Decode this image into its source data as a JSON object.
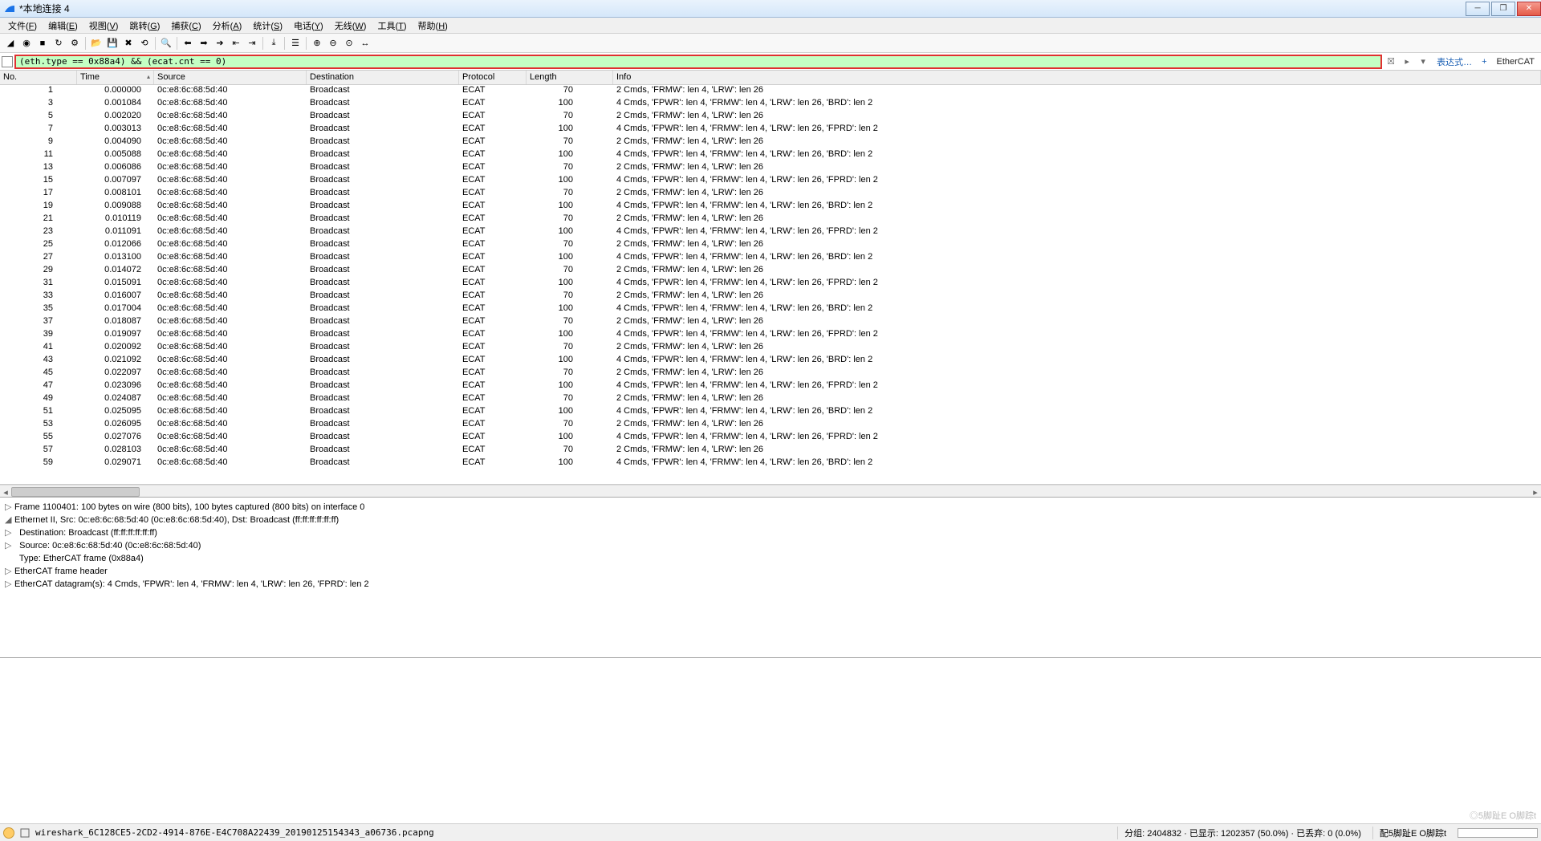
{
  "window": {
    "title": "*本地连接 4"
  },
  "menu": [
    {
      "l": "文件",
      "k": "F"
    },
    {
      "l": "编辑",
      "k": "E"
    },
    {
      "l": "视图",
      "k": "V"
    },
    {
      "l": "跳转",
      "k": "G"
    },
    {
      "l": "捕获",
      "k": "C"
    },
    {
      "l": "分析",
      "k": "A"
    },
    {
      "l": "统计",
      "k": "S"
    },
    {
      "l": "电话",
      "k": "Y"
    },
    {
      "l": "无线",
      "k": "W"
    },
    {
      "l": "工具",
      "k": "T"
    },
    {
      "l": "帮助",
      "k": "H"
    }
  ],
  "filter": {
    "value": "(eth.type == 0x88a4) && (ecat.cnt == 0)"
  },
  "filter_extra": {
    "expression": "表达式…",
    "proto": "EtherCAT"
  },
  "columns": {
    "no": "No.",
    "time": "Time",
    "src": "Source",
    "dst": "Destination",
    "proto": "Protocol",
    "len": "Length",
    "info": "Info"
  },
  "shared": {
    "source": "0c:e8:6c:68:5d:40",
    "destination": "Broadcast",
    "protocol": "ECAT"
  },
  "info_templates": {
    "a": "2 Cmds, 'FRMW': len 4, 'LRW': len 26",
    "b": "4 Cmds, 'FPWR': len 4, 'FRMW': len 4, 'LRW': len 26, 'BRD': len 2",
    "c": "4 Cmds, 'FPWR': len 4, 'FRMW': len 4, 'LRW': len 26, 'FPRD': len 2"
  },
  "packets": [
    {
      "no": 1,
      "time": "0.000000",
      "len": 70,
      "it": "a"
    },
    {
      "no": 3,
      "time": "0.001084",
      "len": 100,
      "it": "b"
    },
    {
      "no": 5,
      "time": "0.002020",
      "len": 70,
      "it": "a"
    },
    {
      "no": 7,
      "time": "0.003013",
      "len": 100,
      "it": "c"
    },
    {
      "no": 9,
      "time": "0.004090",
      "len": 70,
      "it": "a"
    },
    {
      "no": 11,
      "time": "0.005088",
      "len": 100,
      "it": "b"
    },
    {
      "no": 13,
      "time": "0.006086",
      "len": 70,
      "it": "a"
    },
    {
      "no": 15,
      "time": "0.007097",
      "len": 100,
      "it": "c"
    },
    {
      "no": 17,
      "time": "0.008101",
      "len": 70,
      "it": "a"
    },
    {
      "no": 19,
      "time": "0.009088",
      "len": 100,
      "it": "b"
    },
    {
      "no": 21,
      "time": "0.010119",
      "len": 70,
      "it": "a"
    },
    {
      "no": 23,
      "time": "0.011091",
      "len": 100,
      "it": "c"
    },
    {
      "no": 25,
      "time": "0.012066",
      "len": 70,
      "it": "a"
    },
    {
      "no": 27,
      "time": "0.013100",
      "len": 100,
      "it": "b"
    },
    {
      "no": 29,
      "time": "0.014072",
      "len": 70,
      "it": "a"
    },
    {
      "no": 31,
      "time": "0.015091",
      "len": 100,
      "it": "c"
    },
    {
      "no": 33,
      "time": "0.016007",
      "len": 70,
      "it": "a"
    },
    {
      "no": 35,
      "time": "0.017004",
      "len": 100,
      "it": "b"
    },
    {
      "no": 37,
      "time": "0.018087",
      "len": 70,
      "it": "a"
    },
    {
      "no": 39,
      "time": "0.019097",
      "len": 100,
      "it": "c"
    },
    {
      "no": 41,
      "time": "0.020092",
      "len": 70,
      "it": "a"
    },
    {
      "no": 43,
      "time": "0.021092",
      "len": 100,
      "it": "b"
    },
    {
      "no": 45,
      "time": "0.022097",
      "len": 70,
      "it": "a"
    },
    {
      "no": 47,
      "time": "0.023096",
      "len": 100,
      "it": "c"
    },
    {
      "no": 49,
      "time": "0.024087",
      "len": 70,
      "it": "a"
    },
    {
      "no": 51,
      "time": "0.025095",
      "len": 100,
      "it": "b"
    },
    {
      "no": 53,
      "time": "0.026095",
      "len": 70,
      "it": "a"
    },
    {
      "no": 55,
      "time": "0.027076",
      "len": 100,
      "it": "c"
    },
    {
      "no": 57,
      "time": "0.028103",
      "len": 70,
      "it": "a"
    },
    {
      "no": 59,
      "time": "0.029071",
      "len": 100,
      "it": "b"
    }
  ],
  "details": {
    "lines": [
      {
        "indent": 0,
        "tog": "▷",
        "text": "Frame 1100401: 100 bytes on wire (800 bits), 100 bytes captured (800 bits) on interface 0"
      },
      {
        "indent": 0,
        "tog": "◢",
        "text": "Ethernet II, Src: 0c:e8:6c:68:5d:40 (0c:e8:6c:68:5d:40), Dst: Broadcast (ff:ff:ff:ff:ff:ff)"
      },
      {
        "indent": 1,
        "tog": "▷",
        "text": "Destination: Broadcast (ff:ff:ff:ff:ff:ff)"
      },
      {
        "indent": 1,
        "tog": "▷",
        "text": "Source: 0c:e8:6c:68:5d:40 (0c:e8:6c:68:5d:40)"
      },
      {
        "indent": 1,
        "tog": "",
        "text": "Type: EtherCAT frame (0x88a4)"
      },
      {
        "indent": 0,
        "tog": "▷",
        "text": "EtherCAT frame header"
      },
      {
        "indent": 0,
        "tog": "▷",
        "text": "EtherCAT datagram(s): 4 Cmds, 'FPWR': len 4, 'FRMW': len 4, 'LRW': len 26, 'FPRD': len 2"
      }
    ]
  },
  "status": {
    "file": "wireshark_6C128CE5-2CD2-4914-876E-E4C708A22439_20190125154343_a06736.pcapng",
    "packets_label": "分组",
    "packets": "2404832",
    "displayed_label": "已显示",
    "displayed": "1202357",
    "displayed_pct": "(50.0%)",
    "dropped_label": "已丢弃",
    "dropped": "0",
    "dropped_pct": "(0.0%)",
    "profile_label": "配",
    "profile_val": "5脚趾E O脚踪t"
  },
  "toolbar_icons": [
    "shark-fin-icon",
    "record-icon",
    "stop-icon",
    "restart-icon",
    "options-icon",
    "sep",
    "open-icon",
    "save-icon",
    "close-file-icon",
    "reload-icon",
    "sep",
    "find-icon",
    "sep",
    "go-back-icon",
    "go-forward-icon",
    "go-to-packet-icon",
    "go-first-icon",
    "go-last-icon",
    "sep",
    "auto-scroll-icon",
    "sep",
    "colorize-icon",
    "sep",
    "zoom-in-icon",
    "zoom-out-icon",
    "zoom-reset-icon",
    "resize-columns-icon"
  ]
}
